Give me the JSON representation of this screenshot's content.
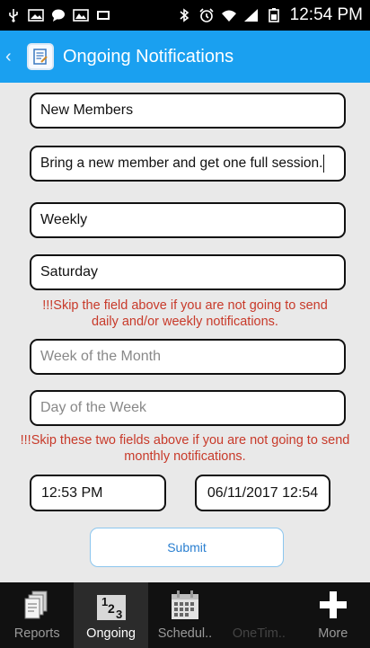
{
  "status_bar": {
    "time": "12:54 PM"
  },
  "header": {
    "title": "Ongoing Notifications"
  },
  "form": {
    "title_value": "New Members",
    "message_value": "Bring a new member and get one full session.",
    "frequency_value": "Weekly",
    "weekday_value": "Saturday",
    "warning_weekly": "!!!Skip the field above if you are not going to send daily and/or weekly notifications.",
    "week_of_month_placeholder": "Week of the Month",
    "day_of_week_placeholder": "Day of the Week",
    "warning_monthly": "!!!Skip these two fields above if you are not going to send monthly notifications.",
    "time_value": "12:53 PM",
    "datetime_value": "06/11/2017 12:54",
    "submit_label": "Submit"
  },
  "tabs": [
    {
      "label": "Reports",
      "icon": "reports-icon"
    },
    {
      "label": "Ongoing",
      "icon": "ongoing-icon"
    },
    {
      "label": "Schedul..",
      "icon": "calendar-icon"
    },
    {
      "label": "OneTim..",
      "icon": "onetime-icon"
    },
    {
      "label": "More",
      "icon": "plus-icon"
    }
  ],
  "colors": {
    "action_bar": "#1aa0f0",
    "warning": "#c83a2a",
    "submit_text": "#2a7fd0"
  }
}
